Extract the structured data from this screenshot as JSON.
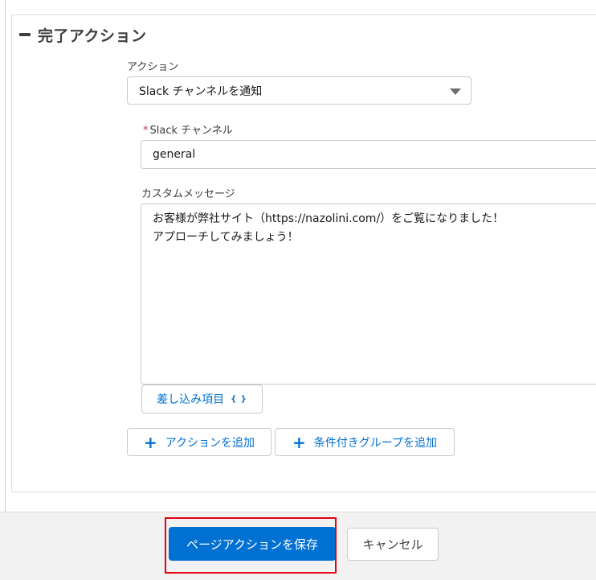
{
  "section": {
    "title": "完了アクション"
  },
  "action": {
    "label": "アクション",
    "selected": "Slack チャンネルを通知"
  },
  "slack_channel": {
    "required_mark": "*",
    "label": "Slack チャンネル",
    "value": "general"
  },
  "custom_message": {
    "label": "カスタムメッセージ",
    "lines": [
      "お客様が弊社サイト（https://nazolini.com/）をご覧になりました！",
      "アプローチしてみましょう！"
    ]
  },
  "merge_field_button": {
    "label": "差し込み項目",
    "icon_text": "{ }"
  },
  "add_action_button": {
    "icon": "+",
    "label": "アクションを追加"
  },
  "add_group_button": {
    "icon": "+",
    "label": "条件付きグループを追加"
  },
  "footer": {
    "save_label": "ページアクションを保存",
    "cancel_label": "キャンセル"
  },
  "colors": {
    "brand": "#0070d2",
    "highlight": "#e60012",
    "required": "#c23934"
  }
}
